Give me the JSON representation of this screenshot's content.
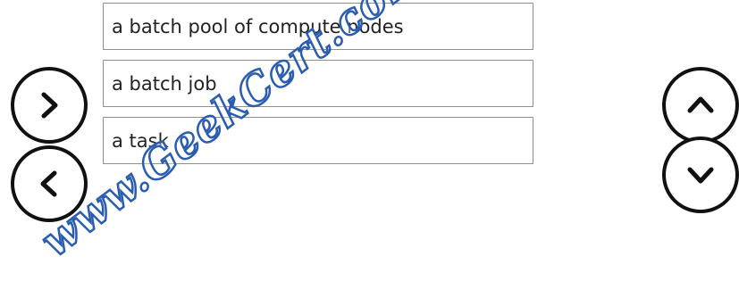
{
  "answer_area": {
    "items": [
      {
        "label": "a batch pool of compute nodes"
      },
      {
        "label": "a batch job"
      },
      {
        "label": "a task"
      }
    ]
  },
  "controls": {
    "move_right_icon": "chevron-right-icon",
    "move_left_icon": "chevron-left-icon",
    "move_up_icon": "chevron-up-icon",
    "move_down_icon": "chevron-down-icon"
  },
  "watermark": {
    "text": "www.GeekCert.com"
  }
}
